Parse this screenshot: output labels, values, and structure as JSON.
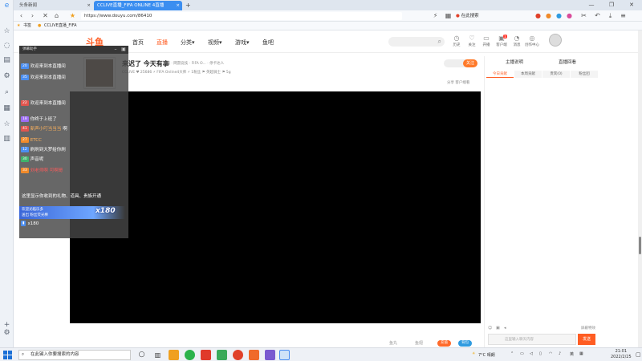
{
  "browser": {
    "tabs": [
      {
        "label": "头条新闻",
        "active": false
      },
      {
        "label": "CCLIVE直播_FIFA ONLINE 4直播",
        "active": true
      }
    ],
    "new_tab": "+",
    "url": "https://www.douyu.com/86410",
    "search_placeholder": "在此搜索",
    "bookmarks": [
      "书签",
      "CCLIVE直播_FIFA"
    ],
    "window_controls": [
      "—",
      "❐",
      "✕"
    ]
  },
  "site": {
    "logo": "斗鱼",
    "nav": [
      {
        "label": "首页",
        "active": false
      },
      {
        "label": "直播",
        "active": true
      },
      {
        "label": "分类▾",
        "active": false
      },
      {
        "label": "视频▾",
        "active": false
      },
      {
        "label": "游戏▾",
        "active": false
      },
      {
        "label": "鱼吧",
        "active": false
      }
    ],
    "header_icons": [
      "历史",
      "关注",
      "开播",
      "客户端",
      "消息",
      "创作中心"
    ],
    "message_badge": "1"
  },
  "room": {
    "title": "来迟了 今天有事",
    "meta": "举报  · 网游竞技 · FIFA O... · 停卡达人",
    "stats": "CCLIVE  ♥ 25686    ⚡ FIFA Online4大师    ⚡ 1粉丝    ⚑ 英超骑士    ⚑ 5g",
    "follow": "关注",
    "share": "分享    客户端看",
    "below_labels": [
      "鱼丸",
      "鱼翅"
    ],
    "gift_buttons": [
      "充值",
      "背包"
    ]
  },
  "right_panel": {
    "tabs": [
      "主播说明",
      "直播回看"
    ],
    "subtabs": [
      "今日贡献",
      "本周贡献",
      "贵宾(0)",
      "粉丝团"
    ],
    "toolbar_right": "屏蔽特效",
    "input_placeholder": "这里输入聊天内容",
    "send": "发送"
  },
  "danmu": {
    "header": "弹幕助手",
    "rows": [
      {
        "lvl": "20",
        "lvlColor": "#4b8ef0",
        "nick": "",
        "text": "欢迎来到本直播间"
      },
      {
        "lvl": "35",
        "lvlColor": "#4b8ef0",
        "nick": "",
        "text": "欢迎来到本直播间"
      },
      {
        "lvl": "22",
        "lvlColor": "#e0554e",
        "nick": "",
        "text": "欢迎来到本直播间"
      },
      {
        "lvl": "18",
        "lvlColor": "#9d6cf5",
        "nick": "",
        "text": "你终于上班了"
      },
      {
        "lvl": "41",
        "lvlColor": "#e0554e",
        "nick": "新声小叮当当当",
        "text": "啊"
      },
      {
        "lvl": "27",
        "lvlColor": "#f08a2a",
        "nick": "ETCC",
        "text": ""
      },
      {
        "lvl": "12",
        "lvlColor": "#4b8ef0",
        "nick": "",
        "text": "刷刷到大罗给你刷"
      },
      {
        "lvl": "30",
        "lvlColor": "#3fb36b",
        "nick": "",
        "text": "声音呢"
      },
      {
        "lvl": "33",
        "lvlColor": "#f08a2a",
        "nick": "刘老师啊",
        "text": "可啊哥"
      }
    ],
    "notice": "这里显示你收到的礼物、道具、贵族开通",
    "gift_banner_user": "欢迎光临乐多",
    "gift_banner_text": "送出  粉丝荧光棒",
    "gift_count": "x180",
    "gift_tail": "x180"
  },
  "taskbar": {
    "search_placeholder": "在此键入你要搜索的内容",
    "weather": "7°C 晴朗",
    "lang": "英",
    "time": "21:01",
    "date": "2022/2/25"
  }
}
